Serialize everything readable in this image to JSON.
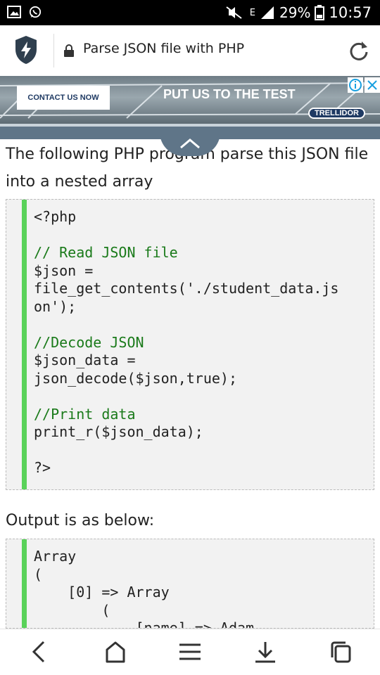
{
  "status_bar": {
    "network_label": "E",
    "battery": "29%",
    "time": "10:57"
  },
  "browser": {
    "page_title": "Parse JSON file with PHP"
  },
  "ad": {
    "contact_label": "CONTACT US NOW",
    "headline": "PUT US TO THE TEST",
    "brand": "TRELLIDOR"
  },
  "article": {
    "intro": "The following PHP program parse this JSON file into a nested array",
    "code_lines": [
      {
        "text": "<?php",
        "type": "code"
      },
      {
        "text": "",
        "type": "code"
      },
      {
        "text": "// Read JSON file",
        "type": "comment"
      },
      {
        "text": "$json =",
        "type": "code"
      },
      {
        "text": "file_get_contents('./student_data.js",
        "type": "code"
      },
      {
        "text": "on');",
        "type": "code"
      },
      {
        "text": "",
        "type": "code"
      },
      {
        "text": "//Decode JSON",
        "type": "comment"
      },
      {
        "text": "$json_data =",
        "type": "code"
      },
      {
        "text": "json_decode($json,true);",
        "type": "code"
      },
      {
        "text": "",
        "type": "code"
      },
      {
        "text": "//Print data",
        "type": "comment"
      },
      {
        "text": "print_r($json_data);",
        "type": "code"
      },
      {
        "text": "",
        "type": "code"
      },
      {
        "text": "?>",
        "type": "code"
      }
    ],
    "output_label": "Output is as below:",
    "output_lines": [
      {
        "text": "Array",
        "type": "code"
      },
      {
        "text": "(",
        "type": "code"
      },
      {
        "text": "    [0] => Array",
        "type": "code"
      },
      {
        "text": "        (",
        "type": "code"
      },
      {
        "text": "            [name] => Adam",
        "type": "code"
      }
    ]
  },
  "colors": {
    "code_accent": "#5ad25a",
    "comment": "#1a7a1a",
    "strip": "#5f7588",
    "ad_brand": "#1f3a63"
  },
  "nav": {
    "icons": [
      "back-icon",
      "home-icon",
      "menu-icon",
      "download-icon",
      "tabs-icon"
    ]
  }
}
